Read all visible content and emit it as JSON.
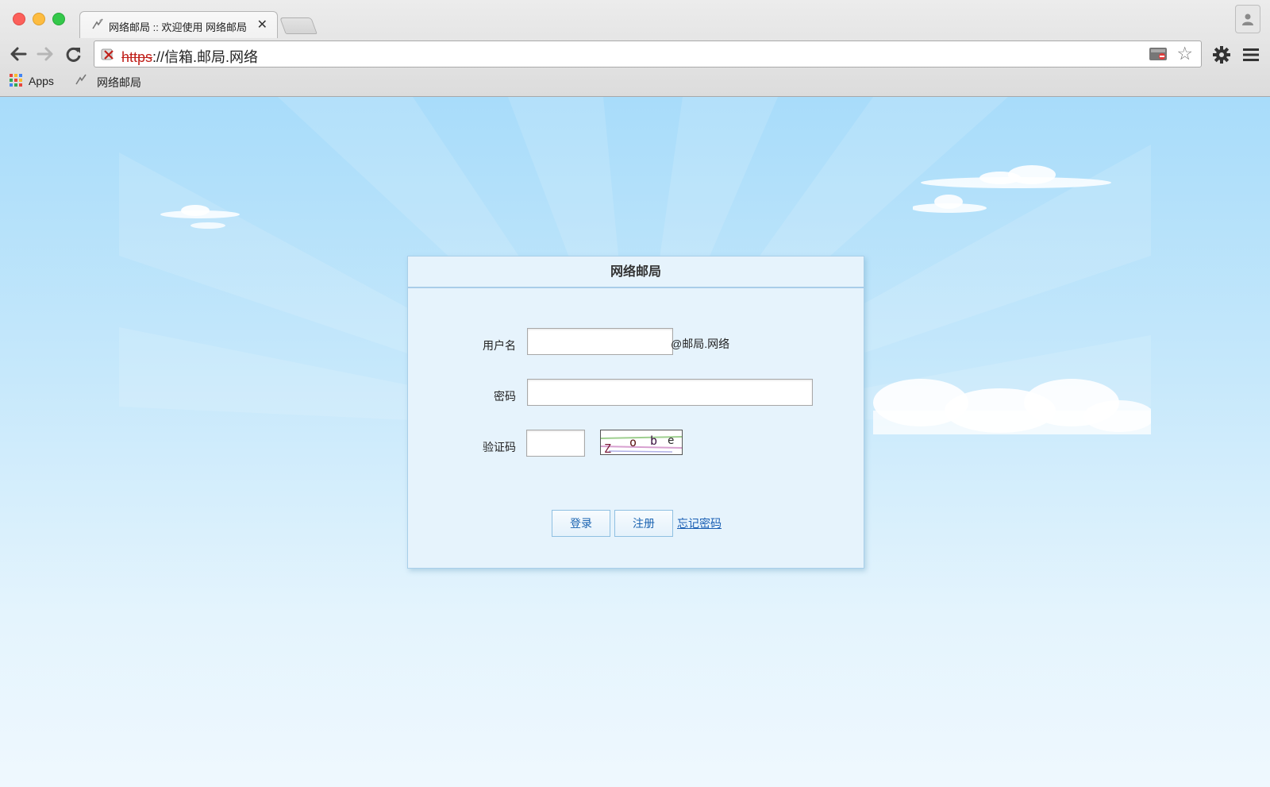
{
  "browser": {
    "tab_title": "网络邮局 :: 欢迎使用 网络邮局",
    "tab_close": "✕",
    "url_scheme": "https",
    "url_rest": "://信箱.邮局.网络",
    "bookmarks": [
      {
        "label": "Apps"
      },
      {
        "label": "网络邮局"
      }
    ]
  },
  "login": {
    "title": "网络邮局",
    "username_label": "用户名",
    "username_value": "",
    "domain_suffix": "@邮局.网络",
    "password_label": "密码",
    "password_value": "",
    "captcha_label": "验证码",
    "captcha_value": "",
    "captcha_text": "Z o b e",
    "login_button": "登录",
    "register_button": "注册",
    "forgot_link": "忘记密码"
  },
  "colors": {
    "sky_top": "#a8dcfa",
    "sky_bottom": "#eff8fe",
    "panel_bg": "#e6f3fc",
    "button_text": "#1b64b1",
    "link": "#1a5fb4",
    "insecure_scheme": "#c0201a"
  }
}
